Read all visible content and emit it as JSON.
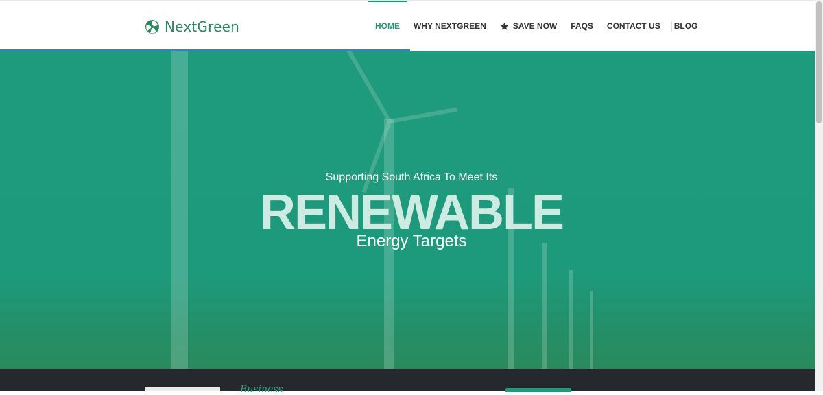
{
  "brand": {
    "name": "NextGreen",
    "color": "#2b8a5c"
  },
  "nav": {
    "items": [
      {
        "label": "HOME",
        "active": true
      },
      {
        "label": "WHY NEXTGREEN",
        "active": false
      },
      {
        "label": "SAVE NOW",
        "active": false,
        "icon": "star-icon"
      },
      {
        "label": "FAQS",
        "active": false
      },
      {
        "label": "CONTACT US",
        "active": false
      },
      {
        "label": "BLOG",
        "active": false
      }
    ],
    "active_color": "#1f9a78"
  },
  "hero": {
    "subtitle": "Supporting South Africa To Meet Its",
    "headline": "RENEWABLE",
    "tagline": "Energy Targets",
    "background_color": "#1e9a7c"
  },
  "footer_band": {
    "script_text": "Business"
  },
  "progress": {
    "value": 0.5
  }
}
